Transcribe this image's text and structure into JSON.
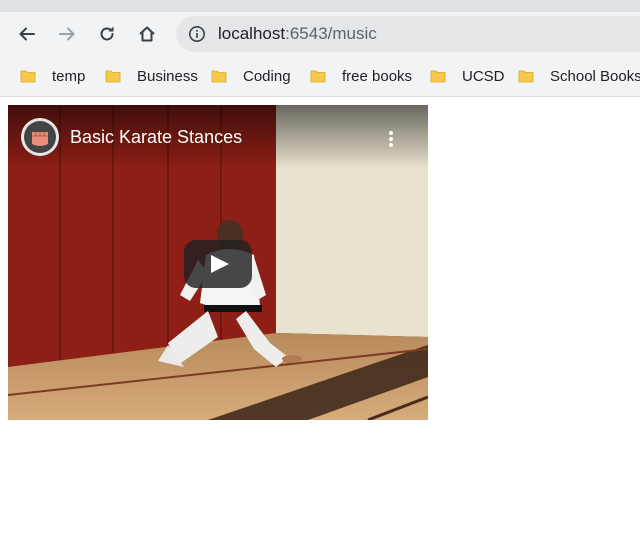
{
  "browser": {
    "url_host": "localhost",
    "url_path": ":6543/music",
    "bookmarks": [
      "temp",
      "Business",
      "Coding",
      "free books",
      "UCSD",
      "School Books"
    ]
  },
  "video": {
    "title": "Basic Karate Stances",
    "player": "YouTube embed"
  },
  "icons": {
    "back": "arrow-left-icon",
    "forward": "arrow-right-icon",
    "reload": "reload-icon",
    "home": "home-icon",
    "info": "info-icon",
    "folder": "folder-icon",
    "menu": "kebab-menu-icon",
    "play": "play-icon"
  },
  "colors": {
    "toolbar": "#f1f3f4",
    "omnibox": "#e4e6e8",
    "folder": "#f7c94a",
    "play_button": "#212121"
  }
}
